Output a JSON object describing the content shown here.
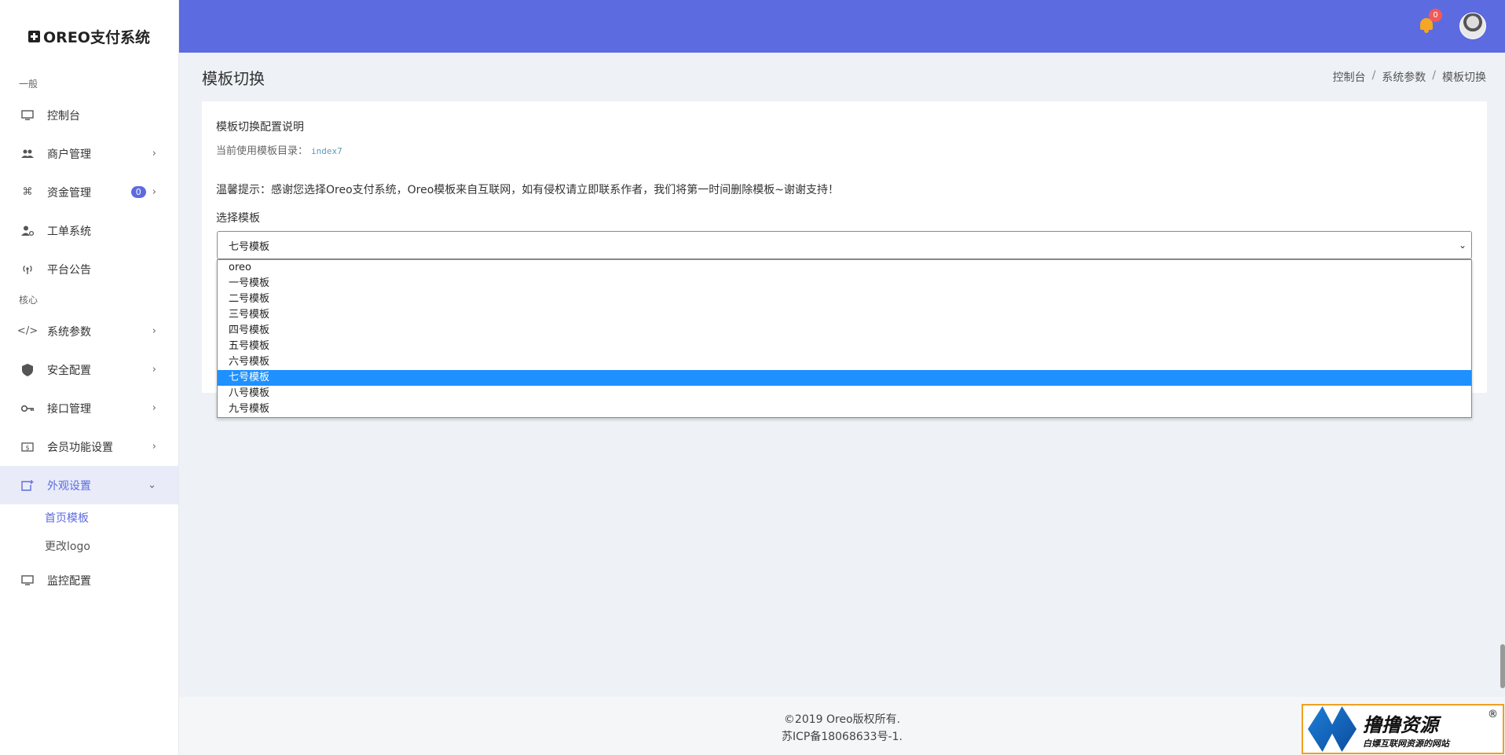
{
  "brand": {
    "name": "OREO支付系统"
  },
  "sidebar": {
    "sections": [
      {
        "title": "一般"
      },
      {
        "title": "核心"
      }
    ],
    "items": [
      {
        "label": "控制台"
      },
      {
        "label": "商户管理"
      },
      {
        "label": "资金管理",
        "badge": "0"
      },
      {
        "label": "工单系统"
      },
      {
        "label": "平台公告"
      },
      {
        "label": "系统参数"
      },
      {
        "label": "安全配置"
      },
      {
        "label": "接口管理"
      },
      {
        "label": "会员功能设置"
      },
      {
        "label": "外观设置"
      },
      {
        "label": "监控配置"
      }
    ],
    "subitems": [
      {
        "label": "首页模板"
      },
      {
        "label": "更改logo"
      }
    ]
  },
  "topbar": {
    "notification_count": "0"
  },
  "page": {
    "title": "模板切换",
    "breadcrumbs": [
      "控制台",
      "系统参数",
      "模板切换"
    ]
  },
  "card": {
    "title": "模板切换配置说明",
    "dir_label": "当前使用模板目录：",
    "dir_value": "index7",
    "tip": "温馨提示：感谢您选择Oreo支付系统，Oreo模板来自互联网，如有侵权请立即联系作者，我们将第一时间删除模板~谢谢支持！",
    "select_label": "选择模板",
    "selected": "七号模板",
    "options": [
      "oreo",
      "一号模板",
      "二号模板",
      "三号模板",
      "四号模板",
      "五号模板",
      "六号模板",
      "七号模板",
      "八号模板",
      "九号模板"
    ]
  },
  "footer": {
    "line1": "©2019 Oreo版权所有.",
    "line2": "苏ICP备18068633号-1."
  },
  "watermark": {
    "main": "撸撸资源",
    "sub": "白嫖互联网资源的网站",
    "reg": "®"
  },
  "colors": {
    "accent": "#5d6be0",
    "selected_option": "#1e90ff",
    "bell": "#f5a623",
    "badge_red": "#f05a5a"
  }
}
